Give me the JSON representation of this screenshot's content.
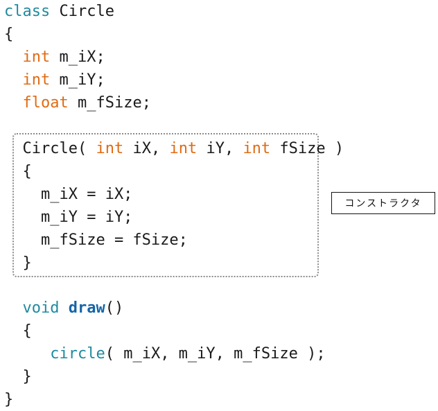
{
  "code": {
    "l1": {
      "kw": "class",
      "rest": " Circle"
    },
    "l2": "{",
    "l3": {
      "indent": "  ",
      "kw": "int",
      "rest": " m_iX;"
    },
    "l4": {
      "indent": "  ",
      "kw": "int",
      "rest": " m_iY;"
    },
    "l5": {
      "indent": "  ",
      "kw": "float",
      "rest": " m_fSize;"
    },
    "l6": {
      "indent": "  ",
      "name": "Circle( ",
      "t1": "int",
      "p1": " iX, ",
      "t2": "int",
      "p2": " iY, ",
      "t3": "int",
      "p3": " fSize )"
    },
    "l7": "  {",
    "l8": "    m_iX = iX;",
    "l9": "    m_iY = iY;",
    "l10": "    m_fSize = fSize;",
    "l11": "  }",
    "l12": {
      "indent": "  ",
      "kw": "void",
      "sp": " ",
      "fn": "draw",
      "rest": "()"
    },
    "l13": "  {",
    "l14": {
      "indent": "     ",
      "fn": "circle",
      "rest": "( m_iX, m_iY, m_fSize );"
    },
    "l15": "  }",
    "l16": "}"
  },
  "annotation": {
    "constructor_label": "コンストラクタ"
  },
  "colors": {
    "keyword_type": "#e06b12",
    "keyword_class": "#1f8a9f",
    "function": "#1565a8"
  }
}
